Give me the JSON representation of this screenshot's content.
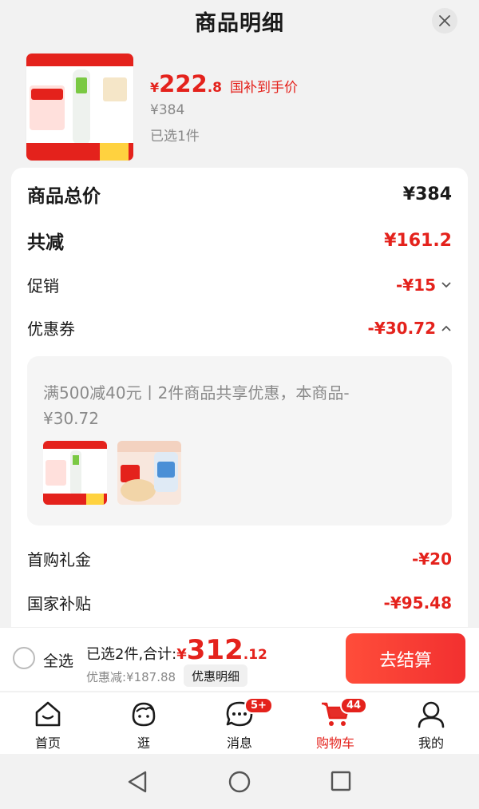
{
  "header": {
    "title": "商品明细"
  },
  "product": {
    "price_symbol": "¥",
    "price_integer": "222",
    "price_decimal": ".8",
    "price_tag": "国补到手价",
    "original_price": "¥384",
    "selected_count": "已选1件"
  },
  "details": {
    "total_label": "商品总价",
    "total_value": "¥384",
    "reduction_label": "共减",
    "reduction_value": "¥161.2",
    "promo_label": "促销",
    "promo_value": "-¥15",
    "coupon_label": "优惠券",
    "coupon_value": "-¥30.72",
    "coupon_desc": "满500减40元丨2件商品共享优惠，本商品-¥30.72",
    "first_gift_label": "首购礼金",
    "first_gift_value": "-¥20",
    "subsidy_label": "国家补贴",
    "subsidy_value": "-¥95.48"
  },
  "bottom_bar": {
    "select_all_label": "全选",
    "total_prefix": "已选2件,合计:",
    "total_symbol": "¥",
    "total_integer": "312",
    "total_decimal": ".12",
    "discount_text": "优惠减:¥187.88",
    "detail_chip": "优惠明细",
    "checkout_label": "去结算"
  },
  "tabs": [
    {
      "label": "首页",
      "icon": "home-icon"
    },
    {
      "label": "逛",
      "icon": "browse-icon"
    },
    {
      "label": "消息",
      "icon": "message-icon",
      "badge": "5+"
    },
    {
      "label": "购物车",
      "icon": "cart-icon",
      "badge": "44",
      "active": true
    },
    {
      "label": "我的",
      "icon": "profile-icon"
    }
  ],
  "colors": {
    "accent": "#e4221c",
    "background": "#f2f2f2"
  }
}
